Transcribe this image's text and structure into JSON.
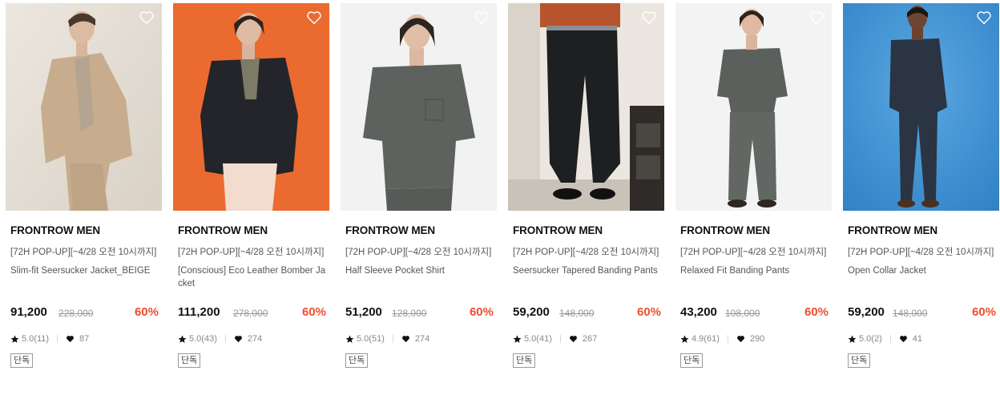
{
  "accent_color": "#ee4e2b",
  "products": [
    {
      "brand": "FRONTROW MEN",
      "promo": "[72H POP-UP][~4/28 오전 10시까지]",
      "name": "Slim-fit Seersucker Jacket_BEIGE",
      "price": "91,200",
      "original_price": "228,000",
      "discount": "60%",
      "rating": "5.0(11)",
      "likes": "87",
      "badge": "단독",
      "image_alt": "Model in beige seersucker suit",
      "icons": {
        "wish": "heart-outline-icon",
        "rating": "star-icon",
        "likes": "heart-icon"
      }
    },
    {
      "brand": "FRONTROW MEN",
      "promo": "[72H POP-UP][~4/28 오전 10시까지]",
      "name": "[Conscious] Eco Leather Bomber Jacket",
      "price": "111,200",
      "original_price": "278,000",
      "discount": "60%",
      "rating": "5.0(43)",
      "likes": "274",
      "badge": "단독",
      "image_alt": "Model in black leather bomber jacket on orange background",
      "icons": {
        "wish": "heart-outline-icon",
        "rating": "star-icon",
        "likes": "heart-icon"
      }
    },
    {
      "brand": "FRONTROW MEN",
      "promo": "[72H POP-UP][~4/28 오전 10시까지]",
      "name": "Half Sleeve Pocket Shirt",
      "price": "51,200",
      "original_price": "128,000",
      "discount": "60%",
      "rating": "5.0(51)",
      "likes": "274",
      "badge": "단독",
      "image_alt": "Model in grey half sleeve shirt",
      "icons": {
        "wish": "heart-outline-icon",
        "rating": "star-icon",
        "likes": "heart-icon"
      }
    },
    {
      "brand": "FRONTROW MEN",
      "promo": "[72H POP-UP][~4/28 오전 10시까지]",
      "name": "Seersucker Tapered Banding Pants",
      "price": "59,200",
      "original_price": "148,000",
      "discount": "60%",
      "rating": "5.0(41)",
      "likes": "267",
      "badge": "단독",
      "image_alt": "Model in black tapered pants",
      "icons": {
        "wish": "heart-outline-icon",
        "rating": "star-icon",
        "likes": "heart-icon"
      }
    },
    {
      "brand": "FRONTROW MEN",
      "promo": "[72H POP-UP][~4/28 오전 10시까지]",
      "name": "Relaxed Fit Banding Pants",
      "price": "43,200",
      "original_price": "108,000",
      "discount": "60%",
      "rating": "4.9(61)",
      "likes": "290",
      "badge": "단독",
      "image_alt": "Model in grey shirt and relaxed pants",
      "icons": {
        "wish": "heart-outline-icon",
        "rating": "star-icon",
        "likes": "heart-icon"
      }
    },
    {
      "brand": "FRONTROW MEN",
      "promo": "[72H POP-UP][~4/28 오전 10시까지]",
      "name": "Open Collar Jacket",
      "price": "59,200",
      "original_price": "148,000",
      "discount": "60%",
      "rating": "5.0(2)",
      "likes": "41",
      "badge": "단독",
      "image_alt": "Model in navy open collar set on blue background",
      "icons": {
        "wish": "heart-outline-icon",
        "rating": "star-icon",
        "likes": "heart-icon"
      }
    }
  ]
}
